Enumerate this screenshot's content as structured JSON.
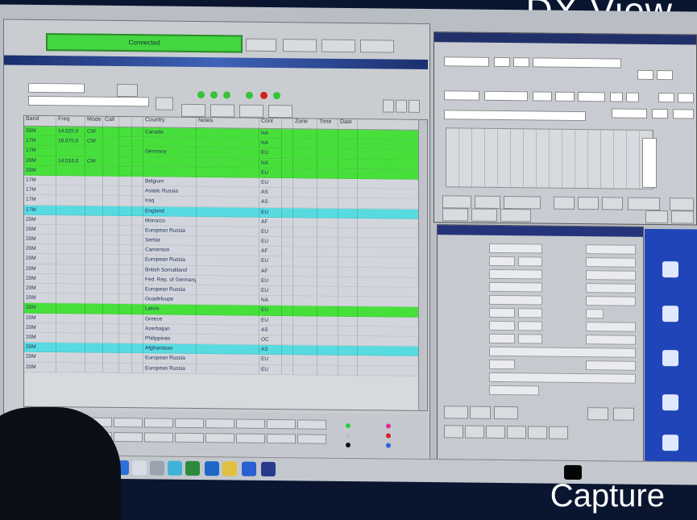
{
  "captions": {
    "top": "DX View",
    "bottom": "Capture"
  },
  "colors": {
    "green_row": "#47e03b",
    "cyan_row": "#57dbe0",
    "status_green": "#43d640",
    "desktop_blue": "#1f45b8"
  },
  "cluster": {
    "status": "Connected",
    "grid": {
      "headers": [
        "Band",
        "Freq",
        "Mode",
        "Call",
        "",
        "",
        "Country",
        "Notes",
        "Cont",
        "",
        "Zone",
        "Time",
        "Date"
      ],
      "rows": [
        {
          "style": "green",
          "cells": [
            "20M",
            "14.025.0",
            "CW",
            "",
            "",
            "",
            "Canada",
            "",
            "NA",
            "",
            "",
            "",
            ""
          ]
        },
        {
          "style": "green",
          "cells": [
            "17M",
            "18.075.0",
            "CW",
            "",
            "",
            "",
            "",
            "",
            "NA",
            "",
            "",
            "",
            ""
          ]
        },
        {
          "style": "green",
          "cells": [
            "17M",
            "",
            "",
            "",
            "",
            "",
            "Germany",
            "",
            "EU",
            "",
            "",
            "",
            ""
          ]
        },
        {
          "style": "green",
          "cells": [
            "20M",
            "14.016.0",
            "CW",
            "",
            "",
            "",
            "",
            "",
            "NA",
            "",
            "",
            "",
            ""
          ]
        },
        {
          "style": "green",
          "cells": [
            "20M",
            "",
            "",
            "",
            "",
            "",
            "",
            "",
            "EU",
            "",
            "",
            "",
            ""
          ]
        },
        {
          "style": "plain",
          "cells": [
            "17M",
            "",
            "",
            "",
            "",
            "",
            "Belgium",
            "",
            "EU",
            "",
            "",
            "",
            ""
          ]
        },
        {
          "style": "plain",
          "cells": [
            "17M",
            "",
            "",
            "",
            "",
            "",
            "Asiatic Russia",
            "",
            "AS",
            "",
            "",
            "",
            ""
          ]
        },
        {
          "style": "plain",
          "cells": [
            "17M",
            "",
            "",
            "",
            "",
            "",
            "Iraq",
            "",
            "AS",
            "",
            "",
            "",
            ""
          ]
        },
        {
          "style": "cyan",
          "cells": [
            "17M",
            "",
            "",
            "",
            "",
            "",
            "England",
            "",
            "EU",
            "",
            "",
            "",
            ""
          ]
        },
        {
          "style": "plain",
          "cells": [
            "20M",
            "",
            "",
            "",
            "",
            "",
            "Morocco",
            "",
            "AF",
            "",
            "",
            "",
            ""
          ]
        },
        {
          "style": "plain",
          "cells": [
            "20M",
            "",
            "",
            "",
            "",
            "",
            "European Russia",
            "",
            "EU",
            "",
            "",
            "",
            ""
          ]
        },
        {
          "style": "plain",
          "cells": [
            "20M",
            "",
            "",
            "",
            "",
            "",
            "Serbia",
            "",
            "EU",
            "",
            "",
            "",
            ""
          ]
        },
        {
          "style": "plain",
          "cells": [
            "20M",
            "",
            "",
            "",
            "",
            "",
            "Cameroon",
            "",
            "AF",
            "",
            "",
            "",
            ""
          ]
        },
        {
          "style": "plain",
          "cells": [
            "20M",
            "",
            "",
            "",
            "",
            "",
            "European Russia",
            "",
            "EU",
            "",
            "",
            "",
            ""
          ]
        },
        {
          "style": "plain",
          "cells": [
            "20M",
            "",
            "",
            "",
            "",
            "",
            "British Somaliland",
            "",
            "AF",
            "",
            "",
            "",
            ""
          ]
        },
        {
          "style": "plain",
          "cells": [
            "20M",
            "",
            "",
            "",
            "",
            "",
            "Fed. Rep. of Germany",
            "",
            "EU",
            "",
            "",
            "",
            ""
          ]
        },
        {
          "style": "plain",
          "cells": [
            "20M",
            "",
            "",
            "",
            "",
            "",
            "European Russia",
            "",
            "EU",
            "",
            "",
            "",
            ""
          ]
        },
        {
          "style": "plain",
          "cells": [
            "20M",
            "",
            "",
            "",
            "",
            "",
            "Guadeloupe",
            "",
            "NA",
            "",
            "",
            "",
            ""
          ]
        },
        {
          "style": "green",
          "cells": [
            "20M",
            "",
            "",
            "",
            "",
            "",
            "Latvia",
            "",
            "EU",
            "",
            "",
            "",
            ""
          ]
        },
        {
          "style": "plain",
          "cells": [
            "20M",
            "",
            "",
            "",
            "",
            "",
            "Greece",
            "",
            "EU",
            "",
            "",
            "",
            ""
          ]
        },
        {
          "style": "plain",
          "cells": [
            "20M",
            "",
            "",
            "",
            "",
            "",
            "Azerbaijan",
            "",
            "AS",
            "",
            "",
            "",
            ""
          ]
        },
        {
          "style": "plain",
          "cells": [
            "20M",
            "",
            "",
            "",
            "",
            "",
            "Philippines",
            "",
            "OC",
            "",
            "",
            "",
            ""
          ]
        },
        {
          "style": "cyan",
          "cells": [
            "20M",
            "",
            "",
            "",
            "",
            "",
            "Afghanistan",
            "",
            "AS",
            "",
            "",
            "",
            ""
          ]
        },
        {
          "style": "plain",
          "cells": [
            "20M",
            "",
            "",
            "",
            "",
            "",
            "European Russia",
            "",
            "EU",
            "",
            "",
            "",
            ""
          ]
        },
        {
          "style": "plain",
          "cells": [
            "20M",
            "",
            "",
            "",
            "",
            "",
            "European Russia",
            "",
            "EU",
            "",
            "",
            "",
            ""
          ]
        }
      ]
    }
  },
  "dx_window": {
    "title": ""
  },
  "log_window": {
    "title": ""
  },
  "desktop_icons": [
    "",
    "",
    "",
    "",
    ""
  ]
}
